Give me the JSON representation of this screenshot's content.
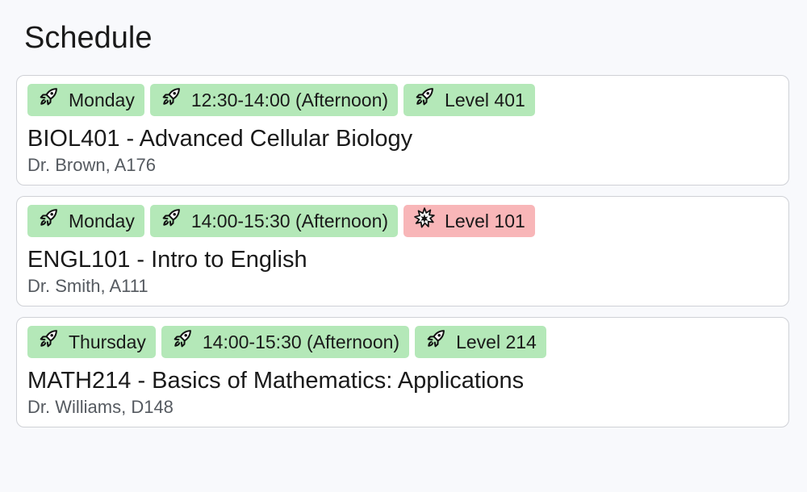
{
  "page": {
    "title": "Schedule"
  },
  "courses": [
    {
      "tags": [
        {
          "label": "Monday",
          "status": "ok",
          "icon": "rocket-icon"
        },
        {
          "label": "12:30-14:00 (Afternoon)",
          "status": "ok",
          "icon": "rocket-icon"
        },
        {
          "label": "Level 401",
          "status": "ok",
          "icon": "rocket-icon"
        }
      ],
      "title": "BIOL401 - Advanced Cellular Biology",
      "subtitle": "Dr. Brown, A176"
    },
    {
      "tags": [
        {
          "label": "Monday",
          "status": "ok",
          "icon": "rocket-icon"
        },
        {
          "label": "14:00-15:30 (Afternoon)",
          "status": "ok",
          "icon": "rocket-icon"
        },
        {
          "label": "Level 101",
          "status": "conflict",
          "icon": "explosion-icon"
        }
      ],
      "title": "ENGL101 - Intro to English",
      "subtitle": "Dr. Smith, A111"
    },
    {
      "tags": [
        {
          "label": "Thursday",
          "status": "ok",
          "icon": "rocket-icon"
        },
        {
          "label": "14:00-15:30 (Afternoon)",
          "status": "ok",
          "icon": "rocket-icon"
        },
        {
          "label": "Level 214",
          "status": "ok",
          "icon": "rocket-icon"
        }
      ],
      "title": "MATH214 - Basics of Mathematics: Applications",
      "subtitle": "Dr. Williams, D148"
    }
  ],
  "colors": {
    "ok_tag": "#b4e8b8",
    "conflict_tag": "#f8b6b8",
    "background": "#f8f9fc",
    "card": "#ffffff",
    "card_border": "#cfd1d6"
  }
}
